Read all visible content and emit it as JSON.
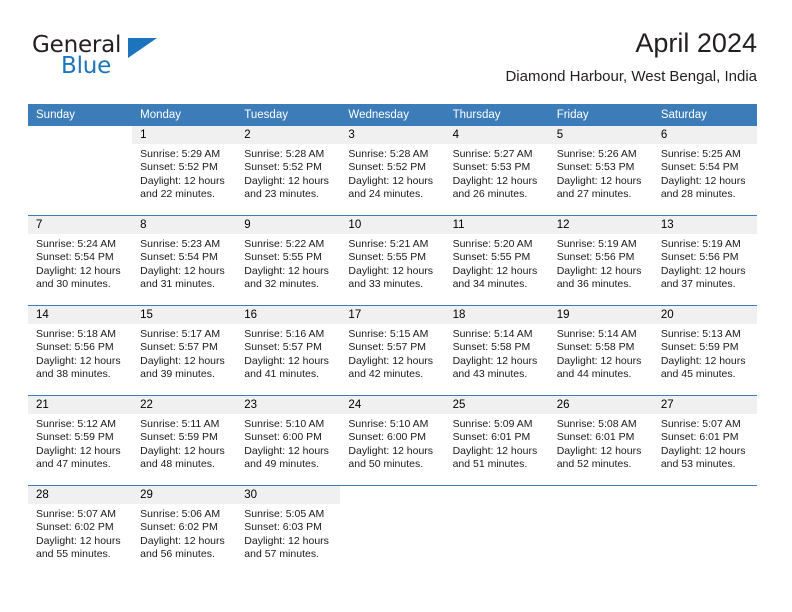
{
  "brand": {
    "name_part1": "General",
    "name_part2": "Blue",
    "triangle_icon": "triangle-icon",
    "accent_color": "#1c75bc"
  },
  "header": {
    "title": "April 2024",
    "subtitle": "Diamond Harbour, West Bengal, India"
  },
  "calendar": {
    "header_bg": "#3c7cb8",
    "daynum_band_bg": "#f0f0f0",
    "weekdays": [
      "Sunday",
      "Monday",
      "Tuesday",
      "Wednesday",
      "Thursday",
      "Friday",
      "Saturday"
    ],
    "weeks": [
      [
        {
          "day": "",
          "blank": true
        },
        {
          "day": "1",
          "sunrise": "Sunrise: 5:29 AM",
          "sunset": "Sunset: 5:52 PM",
          "daylight": "Daylight: 12 hours and 22 minutes."
        },
        {
          "day": "2",
          "sunrise": "Sunrise: 5:28 AM",
          "sunset": "Sunset: 5:52 PM",
          "daylight": "Daylight: 12 hours and 23 minutes."
        },
        {
          "day": "3",
          "sunrise": "Sunrise: 5:28 AM",
          "sunset": "Sunset: 5:52 PM",
          "daylight": "Daylight: 12 hours and 24 minutes."
        },
        {
          "day": "4",
          "sunrise": "Sunrise: 5:27 AM",
          "sunset": "Sunset: 5:53 PM",
          "daylight": "Daylight: 12 hours and 26 minutes."
        },
        {
          "day": "5",
          "sunrise": "Sunrise: 5:26 AM",
          "sunset": "Sunset: 5:53 PM",
          "daylight": "Daylight: 12 hours and 27 minutes."
        },
        {
          "day": "6",
          "sunrise": "Sunrise: 5:25 AM",
          "sunset": "Sunset: 5:54 PM",
          "daylight": "Daylight: 12 hours and 28 minutes."
        }
      ],
      [
        {
          "day": "7",
          "sunrise": "Sunrise: 5:24 AM",
          "sunset": "Sunset: 5:54 PM",
          "daylight": "Daylight: 12 hours and 30 minutes."
        },
        {
          "day": "8",
          "sunrise": "Sunrise: 5:23 AM",
          "sunset": "Sunset: 5:54 PM",
          "daylight": "Daylight: 12 hours and 31 minutes."
        },
        {
          "day": "9",
          "sunrise": "Sunrise: 5:22 AM",
          "sunset": "Sunset: 5:55 PM",
          "daylight": "Daylight: 12 hours and 32 minutes."
        },
        {
          "day": "10",
          "sunrise": "Sunrise: 5:21 AM",
          "sunset": "Sunset: 5:55 PM",
          "daylight": "Daylight: 12 hours and 33 minutes."
        },
        {
          "day": "11",
          "sunrise": "Sunrise: 5:20 AM",
          "sunset": "Sunset: 5:55 PM",
          "daylight": "Daylight: 12 hours and 34 minutes."
        },
        {
          "day": "12",
          "sunrise": "Sunrise: 5:19 AM",
          "sunset": "Sunset: 5:56 PM",
          "daylight": "Daylight: 12 hours and 36 minutes."
        },
        {
          "day": "13",
          "sunrise": "Sunrise: 5:19 AM",
          "sunset": "Sunset: 5:56 PM",
          "daylight": "Daylight: 12 hours and 37 minutes."
        }
      ],
      [
        {
          "day": "14",
          "sunrise": "Sunrise: 5:18 AM",
          "sunset": "Sunset: 5:56 PM",
          "daylight": "Daylight: 12 hours and 38 minutes."
        },
        {
          "day": "15",
          "sunrise": "Sunrise: 5:17 AM",
          "sunset": "Sunset: 5:57 PM",
          "daylight": "Daylight: 12 hours and 39 minutes."
        },
        {
          "day": "16",
          "sunrise": "Sunrise: 5:16 AM",
          "sunset": "Sunset: 5:57 PM",
          "daylight": "Daylight: 12 hours and 41 minutes."
        },
        {
          "day": "17",
          "sunrise": "Sunrise: 5:15 AM",
          "sunset": "Sunset: 5:57 PM",
          "daylight": "Daylight: 12 hours and 42 minutes."
        },
        {
          "day": "18",
          "sunrise": "Sunrise: 5:14 AM",
          "sunset": "Sunset: 5:58 PM",
          "daylight": "Daylight: 12 hours and 43 minutes."
        },
        {
          "day": "19",
          "sunrise": "Sunrise: 5:14 AM",
          "sunset": "Sunset: 5:58 PM",
          "daylight": "Daylight: 12 hours and 44 minutes."
        },
        {
          "day": "20",
          "sunrise": "Sunrise: 5:13 AM",
          "sunset": "Sunset: 5:59 PM",
          "daylight": "Daylight: 12 hours and 45 minutes."
        }
      ],
      [
        {
          "day": "21",
          "sunrise": "Sunrise: 5:12 AM",
          "sunset": "Sunset: 5:59 PM",
          "daylight": "Daylight: 12 hours and 47 minutes."
        },
        {
          "day": "22",
          "sunrise": "Sunrise: 5:11 AM",
          "sunset": "Sunset: 5:59 PM",
          "daylight": "Daylight: 12 hours and 48 minutes."
        },
        {
          "day": "23",
          "sunrise": "Sunrise: 5:10 AM",
          "sunset": "Sunset: 6:00 PM",
          "daylight": "Daylight: 12 hours and 49 minutes."
        },
        {
          "day": "24",
          "sunrise": "Sunrise: 5:10 AM",
          "sunset": "Sunset: 6:00 PM",
          "daylight": "Daylight: 12 hours and 50 minutes."
        },
        {
          "day": "25",
          "sunrise": "Sunrise: 5:09 AM",
          "sunset": "Sunset: 6:01 PM",
          "daylight": "Daylight: 12 hours and 51 minutes."
        },
        {
          "day": "26",
          "sunrise": "Sunrise: 5:08 AM",
          "sunset": "Sunset: 6:01 PM",
          "daylight": "Daylight: 12 hours and 52 minutes."
        },
        {
          "day": "27",
          "sunrise": "Sunrise: 5:07 AM",
          "sunset": "Sunset: 6:01 PM",
          "daylight": "Daylight: 12 hours and 53 minutes."
        }
      ],
      [
        {
          "day": "28",
          "sunrise": "Sunrise: 5:07 AM",
          "sunset": "Sunset: 6:02 PM",
          "daylight": "Daylight: 12 hours and 55 minutes."
        },
        {
          "day": "29",
          "sunrise": "Sunrise: 5:06 AM",
          "sunset": "Sunset: 6:02 PM",
          "daylight": "Daylight: 12 hours and 56 minutes."
        },
        {
          "day": "30",
          "sunrise": "Sunrise: 5:05 AM",
          "sunset": "Sunset: 6:03 PM",
          "daylight": "Daylight: 12 hours and 57 minutes."
        },
        {
          "day": "",
          "blank": true
        },
        {
          "day": "",
          "blank": true
        },
        {
          "day": "",
          "blank": true
        },
        {
          "day": "",
          "blank": true
        }
      ]
    ]
  }
}
